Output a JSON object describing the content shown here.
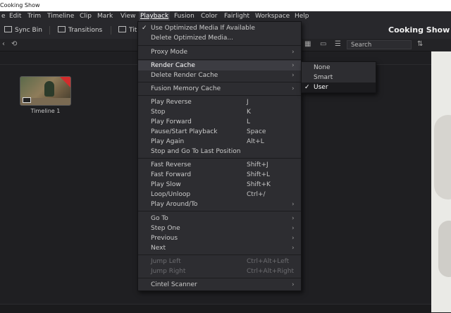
{
  "window": {
    "title": "Cooking Show"
  },
  "menubar": {
    "items": [
      "e",
      "Edit",
      "Trim",
      "Timeline",
      "Clip",
      "Mark",
      "View",
      "Playback",
      "Fusion",
      "Color",
      "Fairlight",
      "Workspace",
      "Help"
    ],
    "active": "Playback"
  },
  "toolbar": {
    "sync_bin": "Sync Bin",
    "transitions": "Transitions",
    "titles_partial": "Tit",
    "project_title": "Cooking Show"
  },
  "search": {
    "placeholder": "Search"
  },
  "media": {
    "clip_label": "Timeline 1"
  },
  "playback_menu": {
    "items": [
      {
        "label": "Use Optimized Media If Available",
        "checked": true
      },
      {
        "label": "Delete Optimized Media..."
      },
      {
        "label": "Proxy Mode",
        "submenu": true
      },
      {
        "label": "Render Cache",
        "submenu": true,
        "highlighted": true
      },
      {
        "label": "Delete Render Cache",
        "submenu": true
      },
      {
        "label": "Fusion Memory Cache",
        "submenu": true
      },
      {
        "label": "Play Reverse",
        "shortcut": "J"
      },
      {
        "label": "Stop",
        "shortcut": "K"
      },
      {
        "label": "Play Forward",
        "shortcut": "L"
      },
      {
        "label": "Pause/Start Playback",
        "shortcut": "Space"
      },
      {
        "label": "Play Again",
        "shortcut": "Alt+L"
      },
      {
        "label": "Stop and Go To Last Position"
      },
      {
        "label": "Fast Reverse",
        "shortcut": "Shift+J"
      },
      {
        "label": "Fast Forward",
        "shortcut": "Shift+L"
      },
      {
        "label": "Play Slow",
        "shortcut": "Shift+K"
      },
      {
        "label": "Loop/Unloop",
        "shortcut": "Ctrl+/"
      },
      {
        "label": "Play Around/To",
        "submenu": true
      },
      {
        "label": "Go To",
        "submenu": true
      },
      {
        "label": "Step One",
        "submenu": true
      },
      {
        "label": "Previous",
        "submenu": true
      },
      {
        "label": "Next",
        "submenu": true
      },
      {
        "label": "Jump Left",
        "shortcut": "Ctrl+Alt+Left",
        "disabled": true
      },
      {
        "label": "Jump Right",
        "shortcut": "Ctrl+Alt+Right",
        "disabled": true
      },
      {
        "label": "Cintel Scanner",
        "submenu": true
      }
    ]
  },
  "render_cache_submenu": {
    "items": [
      {
        "label": "None"
      },
      {
        "label": "Smart"
      },
      {
        "label": "User",
        "checked": true
      }
    ]
  },
  "icons": {
    "check": "check-icon",
    "submenu_arrow": "chevron-right-icon",
    "sync": "sync-icon",
    "grid_view": "grid-view-icon",
    "list_view": "list-view-icon",
    "sort": "sort-icon"
  },
  "colors": {
    "menu_bg": "#2d2d31",
    "highlight": "#3c3c42",
    "clip_flag": "#d22c2c"
  }
}
